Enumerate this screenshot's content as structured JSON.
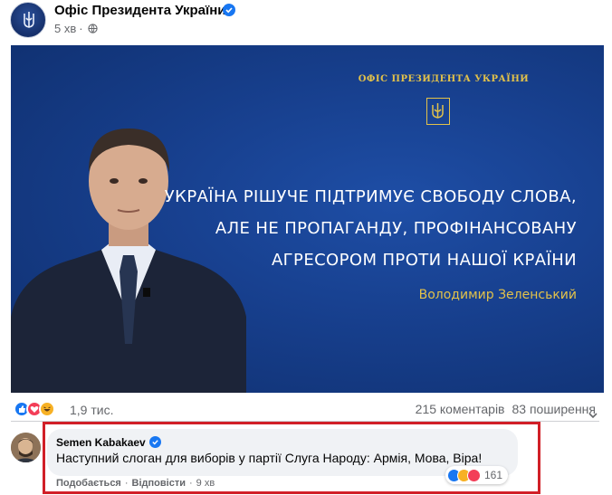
{
  "post": {
    "page_name": "Офіс Президента України",
    "time": "5 хв",
    "separator": "·",
    "image": {
      "header": "ОФІС ПРЕЗИДЕНТА УКРАЇНИ",
      "quote_lines": [
        "УКРАЇНА РІШУЧЕ ПІДТРИМУЄ СВОБОДУ СЛОВА,",
        "АЛЕ НЕ ПРОПАГАНДУ, ПРОФІНАНСОВАНУ",
        "АГРЕСОРОМ ПРОТИ НАШОЇ КРАЇНИ"
      ],
      "signature": "Володимир Зеленський"
    },
    "reactions": {
      "count": "1,9 тис.",
      "comments": "215 коментарів",
      "shares": "83 поширення",
      "types": [
        "like-icon",
        "love-icon",
        "haha-icon"
      ]
    }
  },
  "comment": {
    "author": "Semen Kabakaev",
    "text": "Наступний слоган для виборів у партії Слуга Народу: Армія, Мова, Віра!",
    "reaction_count": "161",
    "like_action": "Подобається",
    "reply_action": "Відповісти",
    "separator": "·",
    "time": "9 хв"
  },
  "colors": {
    "facebook_blue": "#1877f2",
    "highlight_red": "#d11f27",
    "image_gold": "#e3c24a",
    "image_navy": "#173f8d"
  }
}
